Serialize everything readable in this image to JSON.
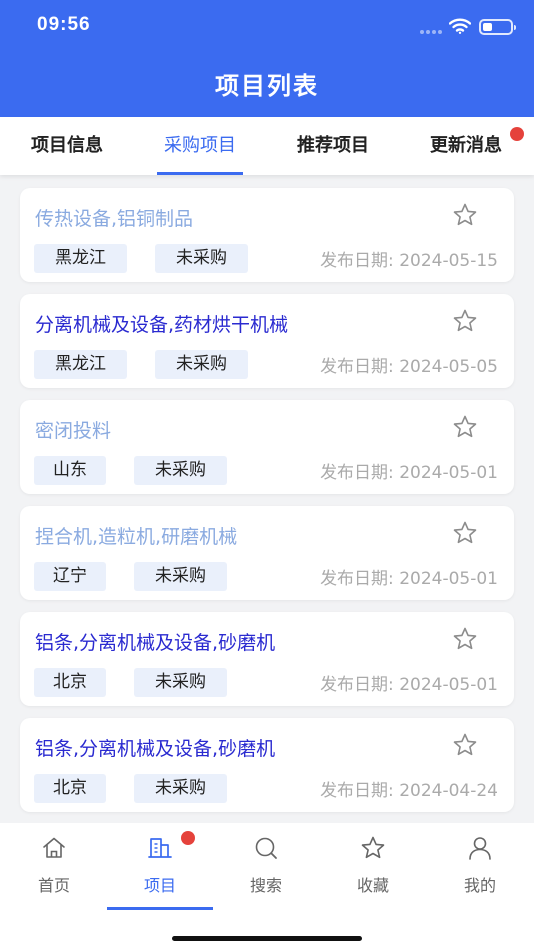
{
  "status_bar": {
    "time": "09:56"
  },
  "header": {
    "title": "项目列表"
  },
  "tabs": [
    {
      "label": "项目信息"
    },
    {
      "label": "采购项目"
    },
    {
      "label": "推荐项目"
    },
    {
      "label": "更新消息"
    }
  ],
  "projects": [
    {
      "title": "传热设备,铝铜制品",
      "title_color": "#8aaae0",
      "region": "黑龙江",
      "status": "未采购",
      "date": "发布日期: 2024-05-15"
    },
    {
      "title": "分离机械及设备,药材烘干机械",
      "title_color": "#2a2ad0",
      "region": "黑龙江",
      "status": "未采购",
      "date": "发布日期: 2024-05-05"
    },
    {
      "title": "密闭投料",
      "title_color": "#8aaae0",
      "region": "山东",
      "status": "未采购",
      "date": "发布日期: 2024-05-01"
    },
    {
      "title": "捏合机,造粒机,研磨机械",
      "title_color": "#8aaae0",
      "region": "辽宁",
      "status": "未采购",
      "date": "发布日期: 2024-05-01"
    },
    {
      "title": "铝条,分离机械及设备,砂磨机",
      "title_color": "#2a2ad0",
      "region": "北京",
      "status": "未采购",
      "date": "发布日期: 2024-05-01"
    },
    {
      "title": "铝条,分离机械及设备,砂磨机",
      "title_color": "#2a2ad0",
      "region": "北京",
      "status": "未采购",
      "date": "发布日期: 2024-04-24"
    }
  ],
  "bottom_nav": [
    {
      "label": "首页",
      "icon": "home-icon"
    },
    {
      "label": "项目",
      "icon": "building-icon"
    },
    {
      "label": "搜索",
      "icon": "search-icon"
    },
    {
      "label": "收藏",
      "icon": "star-icon"
    },
    {
      "label": "我的",
      "icon": "user-icon"
    }
  ],
  "colors": {
    "primary": "#3b6bf0",
    "badge": "#e5423b",
    "tag_bg": "#eaf0fb"
  }
}
